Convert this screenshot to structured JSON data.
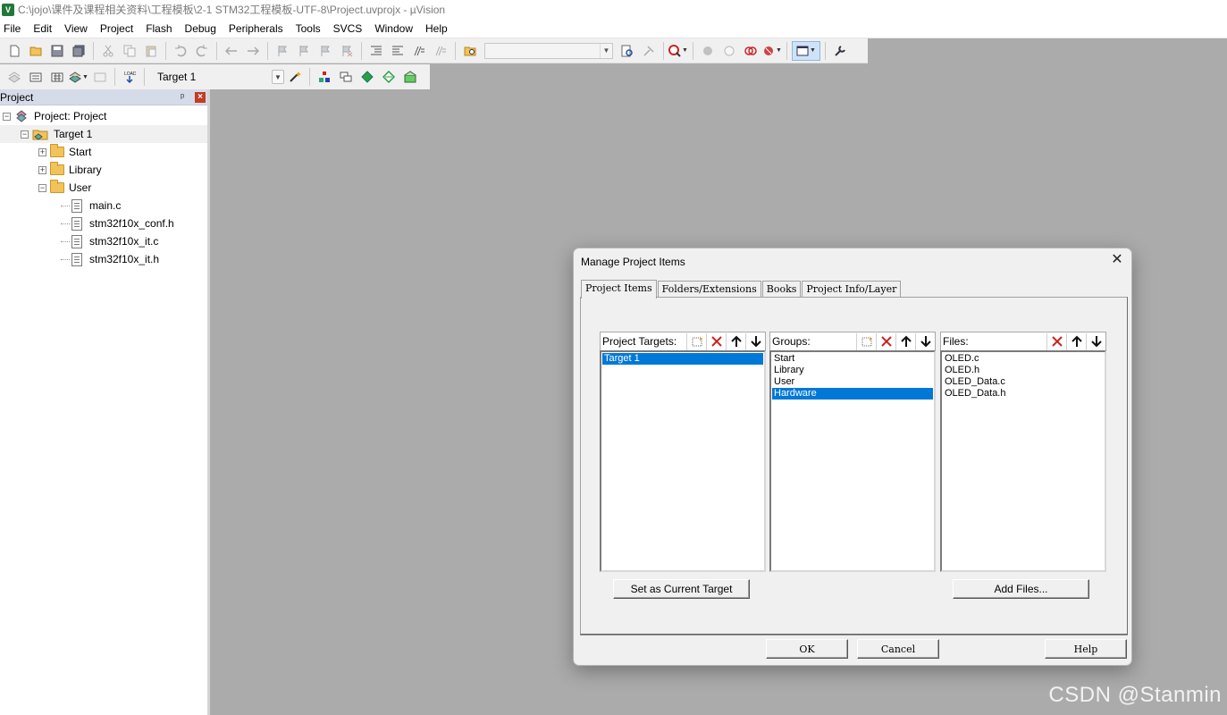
{
  "window": {
    "title": "C:\\jojo\\课件及课程相关资料\\工程模板\\2-1 STM32工程模板-UTF-8\\Project.uvprojx - µVision",
    "app_icon_text": "V"
  },
  "menu": [
    "File",
    "Edit",
    "View",
    "Project",
    "Flash",
    "Debug",
    "Peripherals",
    "Tools",
    "SVCS",
    "Window",
    "Help"
  ],
  "toolbar": {
    "target_select_value": "Target 1"
  },
  "project_panel": {
    "title": "Project",
    "pin_glyph": "ᵖ",
    "close_glyph": "×",
    "root_label": "Project: Project",
    "target_label": "Target 1",
    "groups": [
      "Start",
      "Library",
      "User"
    ],
    "user_files": [
      "main.c",
      "stm32f10x_conf.h",
      "stm32f10x_it.c",
      "stm32f10x_it.h"
    ],
    "expander_open": "−",
    "expander_closed": "+"
  },
  "dialog": {
    "title": "Manage Project Items",
    "close_glyph": "✕",
    "tabs": [
      "Project Items",
      "Folders/Extensions",
      "Books",
      "Project Info/Layer"
    ],
    "targets": {
      "label": "Project Targets:",
      "items": [
        "Target 1"
      ],
      "selected": "Target 1"
    },
    "groups": {
      "label": "Groups:",
      "items": [
        "Start",
        "Library",
        "User",
        "Hardware"
      ],
      "selected": "Hardware"
    },
    "files": {
      "label": "Files:",
      "items": [
        "OLED.c",
        "OLED.h",
        "OLED_Data.c",
        "OLED_Data.h"
      ]
    },
    "buttons": {
      "set_current_target": "Set as Current Target",
      "add_files": "Add Files...",
      "ok": "OK",
      "cancel": "Cancel",
      "help": "Help"
    },
    "selection_color": "#0078d7"
  },
  "watermark": "CSDN @Stanmin"
}
